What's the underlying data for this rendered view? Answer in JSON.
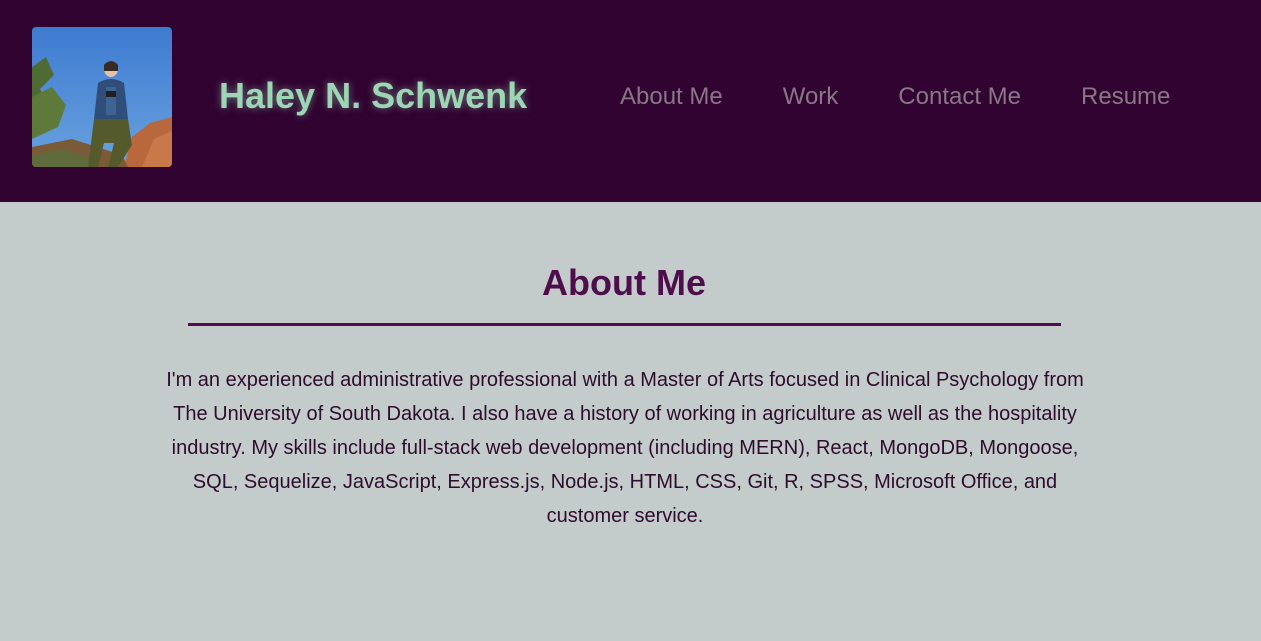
{
  "header": {
    "avatar_alt": "Haley N. Schwenk profile photo",
    "site_title": "Haley N. Schwenk",
    "nav": [
      {
        "label": "About Me"
      },
      {
        "label": "Work"
      },
      {
        "label": "Contact Me"
      },
      {
        "label": "Resume"
      }
    ]
  },
  "main": {
    "section_title": "About Me",
    "about_text": "I'm an experienced administrative professional with a Master of Arts focused in Clinical Psychology from The University of South Dakota. I also have a history of working in agriculture as well as the hospitality industry. My skills include full-stack web development (including MERN), React, MongoDB, Mongoose, SQL, Sequelize, JavaScript, Express.js, Node.js, HTML, CSS, Git, R, SPSS, Microsoft Office, and customer service."
  },
  "colors": {
    "header_bg": "#300330",
    "page_bg": "#c3cccb",
    "title_green": "#9cd6b4",
    "accent_purple": "#4d0e4b",
    "nav_text": "#8a7688"
  }
}
